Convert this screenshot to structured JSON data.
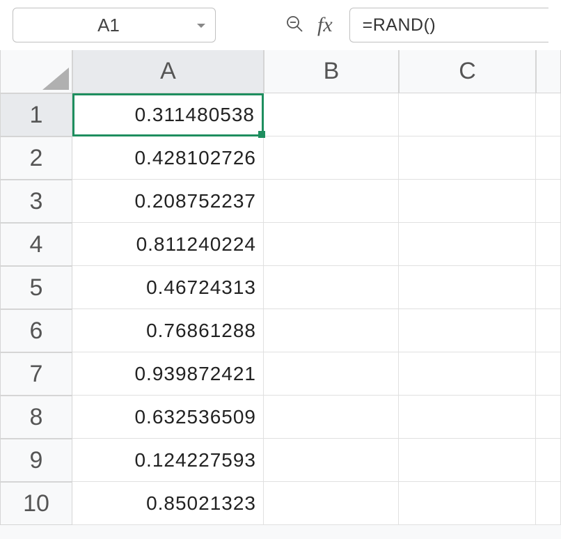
{
  "nameBox": {
    "value": "A1"
  },
  "formula": {
    "value": "=RAND()"
  },
  "columns": [
    "A",
    "B",
    "C",
    ""
  ],
  "rows": [
    {
      "num": "1",
      "values": [
        "0.311480538",
        "",
        "",
        ""
      ]
    },
    {
      "num": "2",
      "values": [
        "0.428102726",
        "",
        "",
        ""
      ]
    },
    {
      "num": "3",
      "values": [
        "0.208752237",
        "",
        "",
        ""
      ]
    },
    {
      "num": "4",
      "values": [
        "0.811240224",
        "",
        "",
        ""
      ]
    },
    {
      "num": "5",
      "values": [
        "0.46724313",
        "",
        "",
        ""
      ]
    },
    {
      "num": "6",
      "values": [
        "0.76861288",
        "",
        "",
        ""
      ]
    },
    {
      "num": "7",
      "values": [
        "0.939872421",
        "",
        "",
        ""
      ]
    },
    {
      "num": "8",
      "values": [
        "0.632536509",
        "",
        "",
        ""
      ]
    },
    {
      "num": "9",
      "values": [
        "0.124227593",
        "",
        "",
        ""
      ]
    },
    {
      "num": "10",
      "values": [
        "0.85021323",
        "",
        "",
        ""
      ]
    }
  ],
  "selectedCell": {
    "row": 0,
    "col": 0
  }
}
